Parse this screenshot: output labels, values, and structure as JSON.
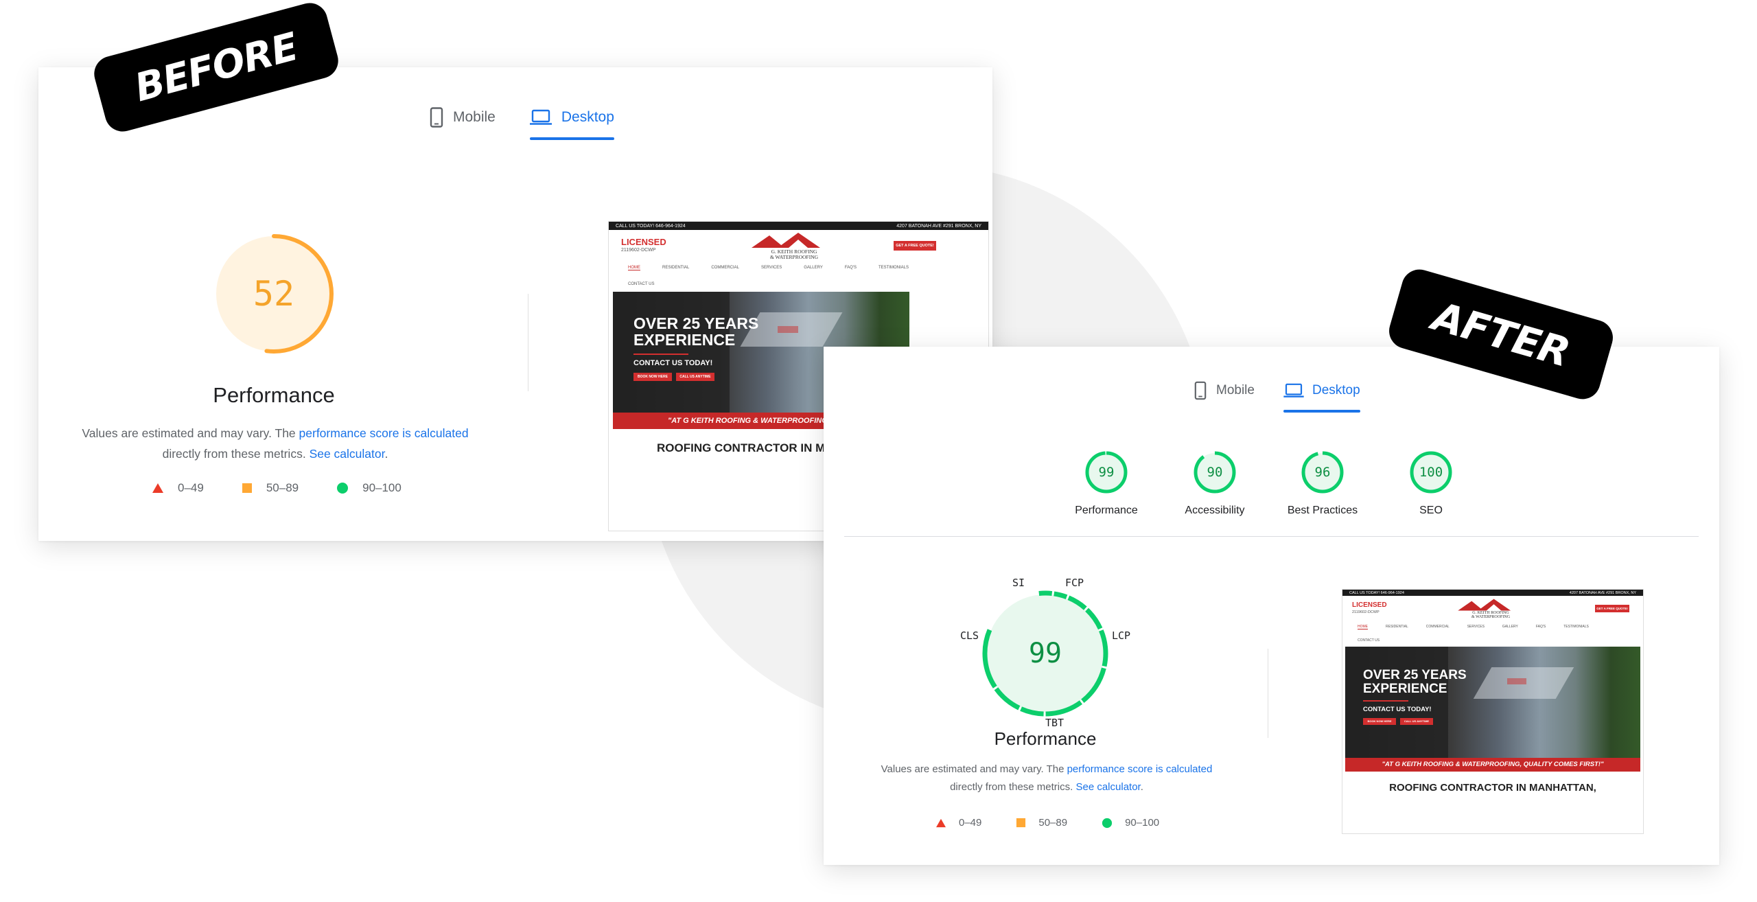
{
  "badges": {
    "before": "BEFORE",
    "after": "AFTER"
  },
  "tabs": {
    "mobile": "Mobile",
    "desktop": "Desktop"
  },
  "before": {
    "performance_score": 52,
    "performance_label": "Performance",
    "desc": {
      "prefix": "Values are estimated and may vary. The ",
      "link1": "performance score is calculated",
      "middle": "directly from these metrics. ",
      "link2": "See calculator",
      "suffix": "."
    }
  },
  "after": {
    "scores": [
      {
        "label": "Performance",
        "value": 99
      },
      {
        "label": "Accessibility",
        "value": 90
      },
      {
        "label": "Best Practices",
        "value": 96
      },
      {
        "label": "SEO",
        "value": 100
      }
    ],
    "performance_score": 99,
    "performance_label": "Performance",
    "metric_labels": {
      "si": "SI",
      "fcp": "FCP",
      "lcp": "LCP",
      "cls": "CLS",
      "tbt": "TBT"
    },
    "desc": {
      "prefix": "Values are estimated and may vary. The ",
      "link1": "performance score is calculated",
      "middle": "directly from these metrics. ",
      "link2": "See calculator",
      "suffix": "."
    }
  },
  "legend": {
    "fail": "0–49",
    "average": "50–89",
    "pass": "90–100"
  },
  "thumbnail": {
    "topbar_left": "CALL US TODAY! 646-964-1924",
    "topbar_right": "4207 BATONAH AVE #291 BRONX, NY",
    "licensed": "LICENSED",
    "license_no": "2119602-DCWP",
    "logo_line1": "G. KEITH ROOFING",
    "logo_line2": "& WATERPROOFING",
    "quote_btn": "GET A FREE QUOTE!",
    "nav": [
      "HOME",
      "RESIDENTIAL",
      "COMMERCIAL",
      "SERVICES",
      "GALLERY",
      "FAQ'S",
      "TESTIMONIALS"
    ],
    "nav_contact": "CONTACT US",
    "hero_line1": "OVER 25 YEARS",
    "hero_line2": "EXPERIENCE",
    "hero_contact": "CONTACT US TODAY!",
    "btn1": "BOOK NOW HERE",
    "btn2": "CALL US ANYTIME",
    "banner_before": "\"AT G KEITH ROOFING & WATERPROOFING, QUALI",
    "banner_after": "\"AT G KEITH ROOFING & WATERPROOFING, QUALITY COMES FIRST!\"",
    "caption_before": "ROOFING CONTRACTOR IN M",
    "caption_after": "ROOFING CONTRACTOR IN MANHATTAN,"
  },
  "colors": {
    "fail": "#eb3b28",
    "average": "#ffa834",
    "pass": "#0cce6b",
    "average_text": "#f4a32a",
    "pass_text": "#0d8f43",
    "link": "#1a73e8",
    "accent_red": "#d32f2f"
  }
}
